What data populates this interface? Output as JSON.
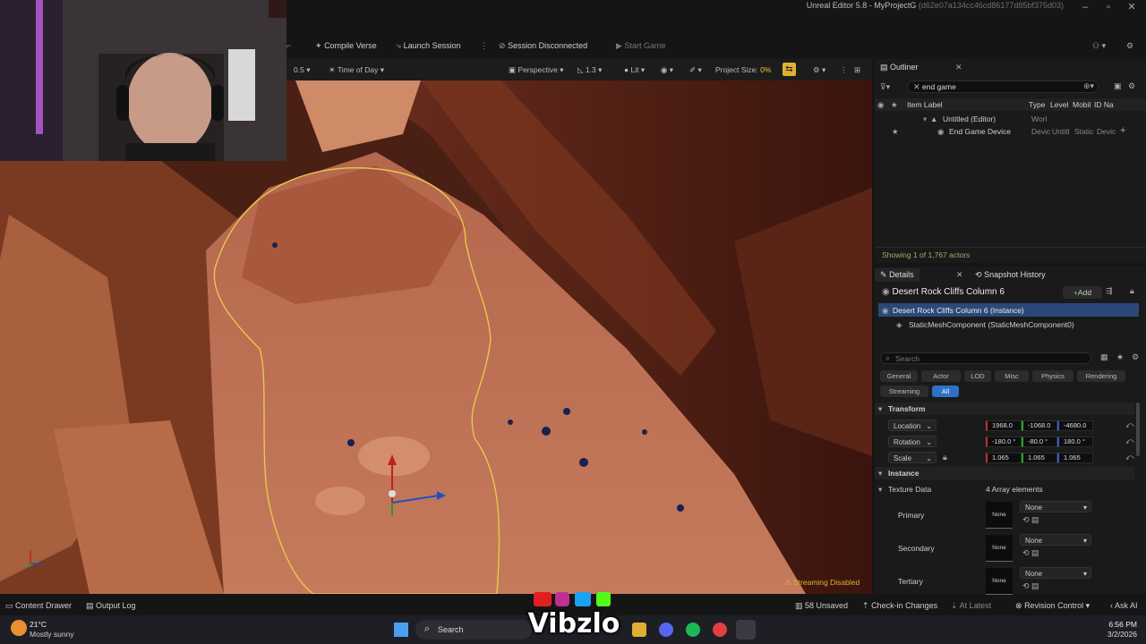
{
  "window": {
    "title": "Unreal Editor 5.8 - MyProjectG",
    "hash": "(d62e07a134cc46cd86177d85bf375d03)"
  },
  "toolbar": {
    "compile": "Compile Verse",
    "launch": "Launch Session",
    "session": "Session Disconnected",
    "start": "Start Game"
  },
  "viewport_bar": {
    "speed": "0.5",
    "time_of_day": "Time of Day",
    "perspective": "Perspective",
    "fov": "1.3",
    "lit": "Lit",
    "project_size_label": "Project Size:",
    "project_size_value": "0%"
  },
  "viewport": {
    "streaming": "Streaming Disabled"
  },
  "outliner": {
    "tab": "Outliner",
    "search": "end game",
    "columns": [
      "Item Label",
      "Type",
      "Level",
      "Mobil",
      "ID Na"
    ],
    "rows": [
      {
        "label": "Untitled (Editor)",
        "type": "Worl"
      },
      {
        "label": "End Game Device",
        "type": "Devic",
        "level": "Untitl",
        "mobility": "Static",
        "id": "Devic"
      }
    ],
    "footer": "Showing 1 of 1,767 actors"
  },
  "details": {
    "tab": "Details",
    "tab2": "Snapshot History",
    "actor": "Desert Rock Cliffs Column 6",
    "add": "Add",
    "components": [
      "Desert Rock Cliffs Column 6 (Instance)",
      "StaticMeshComponent (StaticMeshComponent0)"
    ],
    "search": "Search",
    "filters": [
      "General",
      "Actor",
      "LOD",
      "Misc",
      "Physics",
      "Rendering",
      "Streaming",
      "All"
    ],
    "transform_header": "Transform",
    "location": {
      "label": "Location",
      "values": [
        "1968.0",
        "-1068.0",
        "-4680.0"
      ]
    },
    "rotation": {
      "label": "Rotation",
      "values": [
        "-180.0 °",
        "-80.0 °",
        "180.0 °"
      ]
    },
    "scale": {
      "label": "Scale",
      "values": [
        "1.065",
        "1.065",
        "1.065"
      ]
    },
    "instance_header": "Instance",
    "texture_data": {
      "label": "Texture Data",
      "count": "4 Array elements"
    },
    "texture_slots": [
      {
        "label": "Primary",
        "thumb": "None",
        "value": "None"
      },
      {
        "label": "Secondary",
        "thumb": "None",
        "value": "None"
      },
      {
        "label": "Tertiary",
        "thumb": "None",
        "value": "None"
      }
    ]
  },
  "bottom_bar": {
    "content_drawer": "Content Drawer",
    "output_log": "Output Log",
    "unsaved": "58 Unsaved",
    "checkin": "Check-in Changes",
    "at_latest": "At Latest",
    "revision": "Revision Control",
    "ask_ai": "Ask AI"
  },
  "taskbar": {
    "weather_temp": "21°C",
    "weather_desc": "Mostly sunny",
    "search": "Search",
    "time": "6:56 PM",
    "date": "3/2/2026",
    "watermark": "Vibzlo"
  },
  "colors": {
    "accent_blue": "#1e5ea8",
    "selection_outline": "#e8c84a",
    "project_size_yellow": "#f0c040"
  }
}
